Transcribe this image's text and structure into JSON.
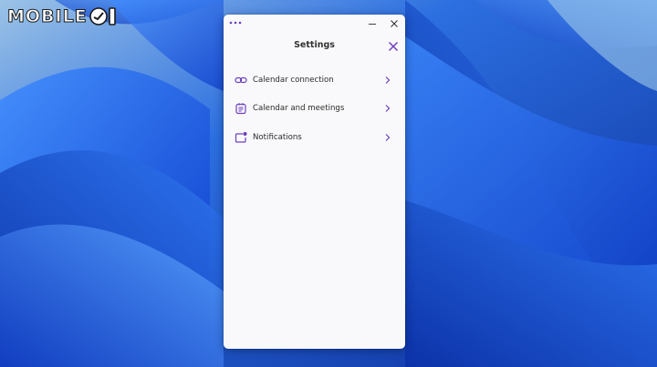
{
  "watermark": {
    "text": "MOBILE"
  },
  "window": {
    "title": "Settings",
    "menu": [
      {
        "label": "Calendar connection",
        "icon": "link-icon"
      },
      {
        "label": "Calendar and meetings",
        "icon": "calendar-icon"
      },
      {
        "label": "Notifications",
        "icon": "notification-icon"
      }
    ]
  },
  "colors": {
    "accent": "#6b3fbf",
    "panel": "#f9f9fb",
    "wallpaper": "#1f5fd8"
  }
}
